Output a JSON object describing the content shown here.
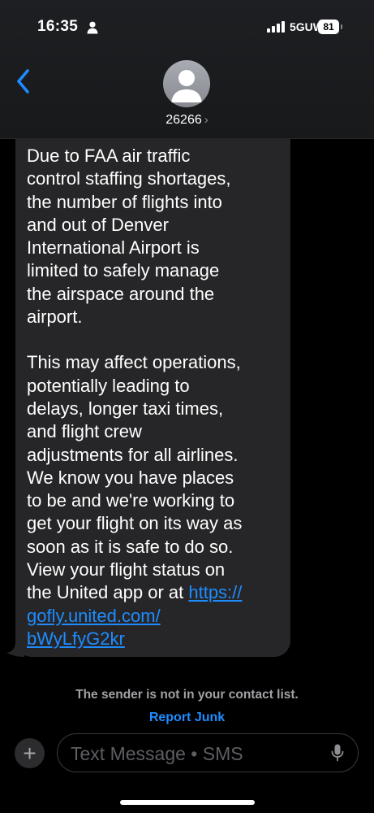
{
  "status_bar": {
    "time": "16:35",
    "network": "5GUW",
    "battery": "81"
  },
  "header": {
    "contact_name": "26266",
    "chevron": "›",
    "back_icon": "chevron-left-icon",
    "avatar_icon": "person-silhouette-icon"
  },
  "message": {
    "paragraph_1": "Due to FAA air traffic\ncontrol staffing shortages,\nthe number of flights into\nand out of Denver\nInternational Airport is\nlimited to safely manage\nthe airspace around the\nairport.",
    "paragraph_2_text": "This may affect operations,\npotentially leading to\ndelays, longer taxi times,\nand flight crew\nadjustments for all airlines.\nWe know you have places\nto be and we're working to\nget your flight on its way as\nsoon as it is safe to do so.\nView your flight status on\nthe United app or at ",
    "link": "https://\ngofly.united.com/\nbWyLfyG2kr"
  },
  "notice": {
    "text": "The sender is not in your contact list.",
    "report_label": "Report Junk"
  },
  "composer": {
    "plus": "+",
    "placeholder": "Text Message • SMS",
    "mic_icon": "microphone-icon"
  },
  "colors": {
    "accent": "#1e8cff",
    "bubble": "#262628",
    "background": "#000000"
  }
}
